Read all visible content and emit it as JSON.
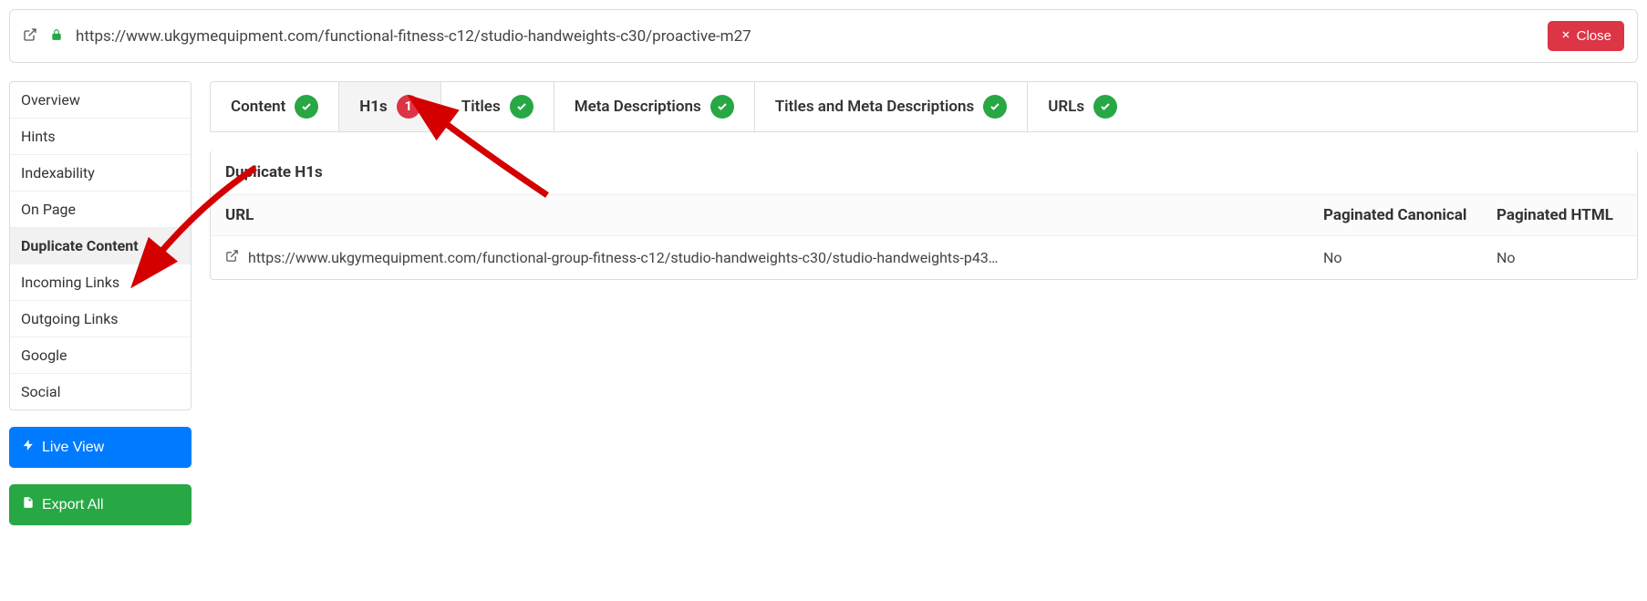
{
  "urlbar": {
    "url": "https://www.ukgymequipment.com/functional-fitness-c12/studio-handweights-c30/proactive-m27",
    "close_label": "Close"
  },
  "sidebar": {
    "items": [
      {
        "label": "Overview"
      },
      {
        "label": "Hints"
      },
      {
        "label": "Indexability"
      },
      {
        "label": "On Page"
      },
      {
        "label": "Duplicate Content"
      },
      {
        "label": "Incoming Links"
      },
      {
        "label": "Outgoing Links"
      },
      {
        "label": "Google"
      },
      {
        "label": "Social"
      }
    ],
    "live_view_label": "Live View",
    "export_all_label": "Export All"
  },
  "tabs": [
    {
      "label": "Content",
      "status": "ok"
    },
    {
      "label": "H1s",
      "status": "count",
      "count": "1"
    },
    {
      "label": "Titles",
      "status": "ok"
    },
    {
      "label": "Meta Descriptions",
      "status": "ok"
    },
    {
      "label": "Titles and Meta Descriptions",
      "status": "ok"
    },
    {
      "label": "URLs",
      "status": "ok"
    }
  ],
  "panel": {
    "title": "Duplicate H1s",
    "columns": {
      "url": "URL",
      "paginated_canonical": "Paginated Canonical",
      "paginated_html": "Paginated HTML"
    },
    "rows": [
      {
        "url": "https://www.ukgymequipment.com/functional-group-fitness-c12/studio-handweights-c30/studio-handweights-p43…",
        "paginated_canonical": "No",
        "paginated_html": "No"
      }
    ]
  }
}
